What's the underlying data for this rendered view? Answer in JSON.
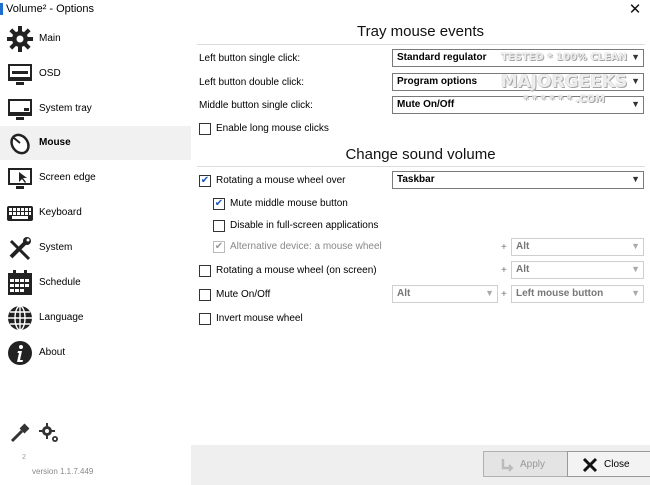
{
  "window": {
    "title": "Volume² - Options",
    "close_glyph": "✕"
  },
  "sidebar": {
    "items": [
      {
        "label": "Main",
        "icon": "gear-icon",
        "active": false
      },
      {
        "label": "OSD",
        "icon": "monitor-icon",
        "active": false
      },
      {
        "label": "System tray",
        "icon": "monitor-tray-icon",
        "active": false
      },
      {
        "label": "Mouse",
        "icon": "mouse-icon",
        "active": true
      },
      {
        "label": "Screen edge",
        "icon": "screen-edge-icon",
        "active": false
      },
      {
        "label": "Keyboard",
        "icon": "keyboard-icon",
        "active": false
      },
      {
        "label": "System",
        "icon": "tools-icon",
        "active": false
      },
      {
        "label": "Schedule",
        "icon": "calendar-icon",
        "active": false
      },
      {
        "label": "Language",
        "icon": "globe-icon",
        "active": false
      },
      {
        "label": "About",
        "icon": "info-icon",
        "active": false
      }
    ],
    "version_sup": "2",
    "version": "version 1.1.7.449"
  },
  "tray": {
    "title": "Tray mouse events",
    "left_single_label": "Left button single click:",
    "left_single_value": "Standard regulator",
    "left_double_label": "Left button double click:",
    "left_double_value": "Program options",
    "middle_single_label": "Middle button single click:",
    "middle_single_value": "Mute On/Off",
    "long_clicks_label": "Enable long mouse clicks"
  },
  "sound": {
    "title": "Change sound volume",
    "rotating_over_label": "Rotating a mouse wheel over",
    "rotating_over_value": "Taskbar",
    "mute_middle_label": "Mute middle mouse button",
    "disable_fullscreen_label": "Disable in full-screen applications",
    "alt_device_label": "Alternative device: a mouse wheel",
    "alt_device_mod": "Alt",
    "rotating_screen_label": "Rotating a mouse wheel (on screen)",
    "rotating_screen_mod": "Alt",
    "mute_onoff_label": "Mute On/Off",
    "mute_onoff_mod": "Alt",
    "mute_onoff_button": "Left mouse button",
    "invert_label": "Invert mouse wheel",
    "plus": "+"
  },
  "watermark": {
    "line1": "TESTED * 100% CLEAN",
    "line2": "MAJORGEEKS",
    "line3": "* * * * * * .COM"
  },
  "footer": {
    "apply_label": "Apply",
    "close_label": "Close"
  },
  "colors": {
    "accent_check": "#1a56b4",
    "active_nav_bg": "#f1f1f1",
    "footer_bg": "#efefef"
  }
}
